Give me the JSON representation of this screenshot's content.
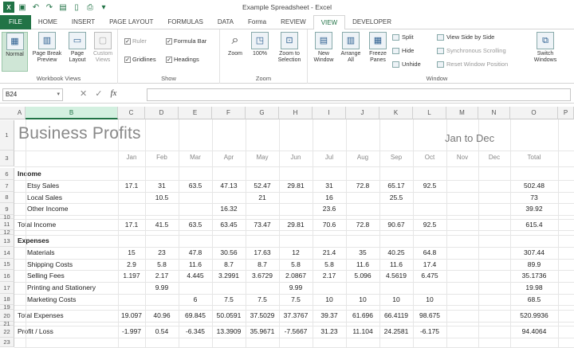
{
  "window": {
    "title": "Example Spreadsheet - Excel"
  },
  "tabs": [
    "FILE",
    "HOME",
    "INSERT",
    "PAGE LAYOUT",
    "FORMULAS",
    "DATA",
    "Forma",
    "REVIEW",
    "VIEW",
    "DEVELOPER"
  ],
  "active_tab": "VIEW",
  "ribbon": {
    "workbook_views": {
      "label": "Workbook Views",
      "normal": "Normal",
      "page_break": "Page Break\nPreview",
      "page_layout": "Page\nLayout",
      "custom": "Custom\nViews"
    },
    "show": {
      "label": "Show",
      "ruler": "Ruler",
      "formula_bar": "Formula Bar",
      "gridlines": "Gridlines",
      "headings": "Headings"
    },
    "zoom": {
      "label": "Zoom",
      "zoom": "Zoom",
      "hundred": "100%",
      "to_selection": "Zoom to\nSelection"
    },
    "window": {
      "label": "Window",
      "new_window": "New\nWindow",
      "arrange_all": "Arrange\nAll",
      "freeze": "Freeze\nPanes",
      "split": "Split",
      "hide": "Hide",
      "unhide": "Unhide",
      "side_by_side": "View Side by Side",
      "sync_scroll": "Synchronous Scrolling",
      "reset_pos": "Reset Window Position",
      "switch": "Switch\nWindows"
    }
  },
  "formula_bar": {
    "name_box": "B24",
    "fx": "fx",
    "value": ""
  },
  "columns": [
    "A",
    "B",
    "C",
    "D",
    "E",
    "F",
    "G",
    "H",
    "I",
    "J",
    "K",
    "L",
    "M",
    "N",
    "O",
    "P"
  ],
  "sheet": {
    "title": "Business Profits",
    "range": "Jan to Dec",
    "months": [
      "Jan",
      "Feb",
      "Mar",
      "Apr",
      "May",
      "Jun",
      "Jul",
      "Aug",
      "Sep",
      "Oct",
      "Nov",
      "Dec",
      "Total"
    ],
    "rows": [
      {
        "n": "1",
        "label": "",
        "vals": []
      },
      {
        "n": "3",
        "label": "",
        "vals": []
      },
      {
        "n": "6",
        "label": "Income",
        "bold": true,
        "vals": []
      },
      {
        "n": "7",
        "label": "Etsy Sales",
        "indent": true,
        "vals": [
          "17.1",
          "31",
          "63.5",
          "47.13",
          "52.47",
          "29.81",
          "31",
          "72.8",
          "65.17",
          "92.5",
          "",
          "",
          "502.48"
        ]
      },
      {
        "n": "8",
        "label": "Local Sales",
        "indent": true,
        "vals": [
          "",
          "10.5",
          "",
          "",
          "21",
          "",
          "16",
          "",
          "25.5",
          "",
          "",
          "",
          "73"
        ]
      },
      {
        "n": "9",
        "label": "Other Income",
        "indent": true,
        "vals": [
          "",
          "",
          "",
          "16.32",
          "",
          "",
          "23.6",
          "",
          "",
          "",
          "",
          "",
          "39.92"
        ]
      },
      {
        "n": "10",
        "label": "",
        "vals": []
      },
      {
        "n": "11",
        "label": "Total Income",
        "vals": [
          "17.1",
          "41.5",
          "63.5",
          "63.45",
          "73.47",
          "29.81",
          "70.6",
          "72.8",
          "90.67",
          "92.5",
          "",
          "",
          "615.4"
        ]
      },
      {
        "n": "12",
        "label": "",
        "vals": []
      },
      {
        "n": "13",
        "label": "Expenses",
        "bold": true,
        "vals": []
      },
      {
        "n": "14",
        "label": "Materials",
        "indent": true,
        "vals": [
          "15",
          "23",
          "47.8",
          "30.56",
          "17.63",
          "12",
          "21.4",
          "35",
          "40.25",
          "64.8",
          "",
          "",
          "307.44"
        ]
      },
      {
        "n": "15",
        "label": "Shipping Costs",
        "indent": true,
        "vals": [
          "2.9",
          "5.8",
          "11.6",
          "8.7",
          "8.7",
          "5.8",
          "5.8",
          "11.6",
          "11.6",
          "17.4",
          "",
          "",
          "89.9"
        ]
      },
      {
        "n": "16",
        "label": "Selling Fees",
        "indent": true,
        "vals": [
          "1.197",
          "2.17",
          "4.445",
          "3.2991",
          "3.6729",
          "2.0867",
          "2.17",
          "5.096",
          "4.5619",
          "6.475",
          "",
          "",
          "35.1736"
        ]
      },
      {
        "n": "17",
        "label": "Printing and Stationery",
        "indent": true,
        "vals": [
          "",
          "9.99",
          "",
          "",
          "",
          "9.99",
          "",
          "",
          "",
          "",
          "",
          "",
          "19.98"
        ]
      },
      {
        "n": "18",
        "label": "Marketing Costs",
        "indent": true,
        "vals": [
          "",
          "",
          "6",
          "7.5",
          "7.5",
          "7.5",
          "10",
          "10",
          "10",
          "10",
          "",
          "",
          "68.5"
        ]
      },
      {
        "n": "19",
        "label": "",
        "vals": []
      },
      {
        "n": "20",
        "label": "Total Expenses",
        "vals": [
          "19.097",
          "40.96",
          "69.845",
          "50.0591",
          "37.5029",
          "37.3767",
          "39.37",
          "61.696",
          "66.4119",
          "98.675",
          "",
          "",
          "520.9936"
        ]
      },
      {
        "n": "21",
        "label": "",
        "vals": []
      },
      {
        "n": "22",
        "label": "Profit / Loss",
        "vals": [
          "-1.997",
          "0.54",
          "-6.345",
          "13.3909",
          "35.9671",
          "-7.5667",
          "31.23",
          "11.104",
          "24.2581",
          "-6.175",
          "",
          "",
          "94.4064"
        ]
      },
      {
        "n": "23",
        "label": "",
        "vals": []
      }
    ]
  }
}
